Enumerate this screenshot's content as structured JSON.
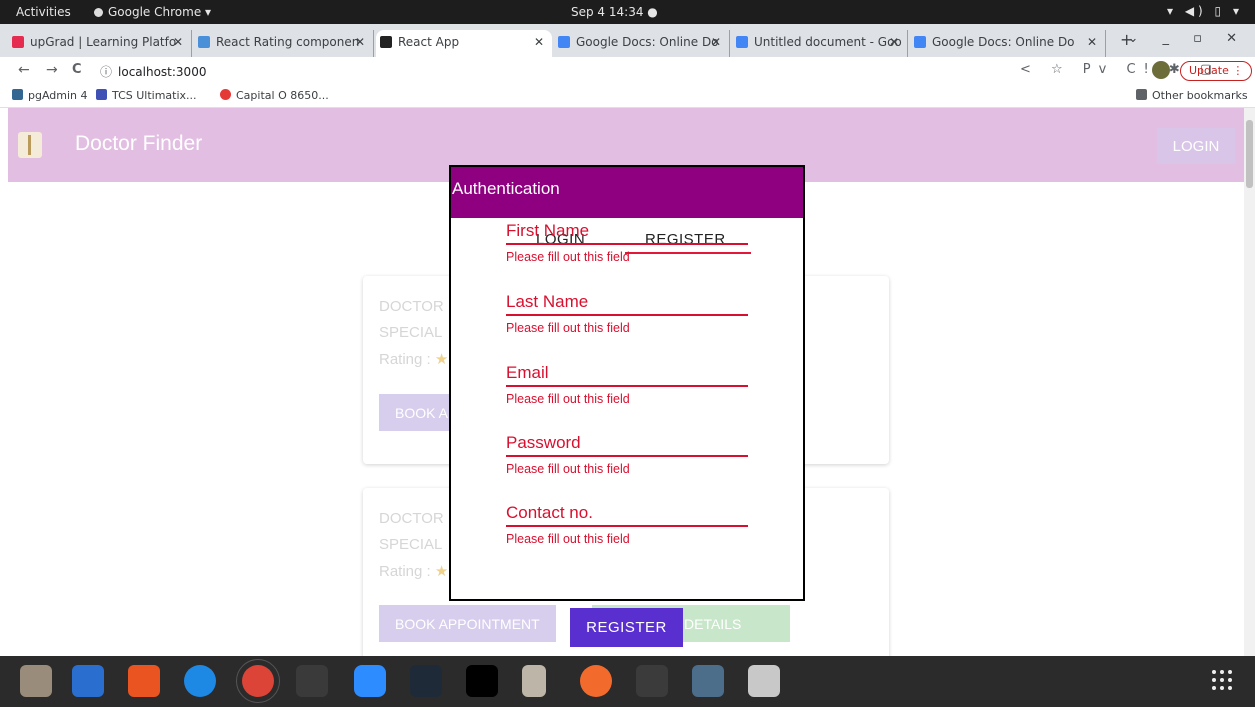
{
  "system": {
    "activities": "Activities",
    "app_name": "Google Chrome ▾",
    "clock": "Sep 4  14:34  ●",
    "tray": "▾ ◀) ▯ ▾"
  },
  "browser": {
    "tabs": [
      {
        "label": "upGrad | Learning Platfo",
        "favicon_color": "#e52b50"
      },
      {
        "label": "React Rating componen",
        "favicon_color": "#4a90d9"
      },
      {
        "label": "React App",
        "favicon_color": "#222222"
      },
      {
        "label": "Google Docs: Online Do",
        "favicon_color": "#4285f4"
      },
      {
        "label": "Untitled document - Goo",
        "favicon_color": "#4285f4"
      },
      {
        "label": "Google Docs: Online Do",
        "favicon_color": "#4285f4"
      }
    ],
    "new_tab": "+",
    "window_controls": "⌄ _ ▫ ✕",
    "nav": {
      "back": "←",
      "forward": "→",
      "reload": "C"
    },
    "url": "localhost:3000",
    "nav_icons": "< ☆ Pv C! ✱ ▢",
    "update_label": "Update ⋮",
    "bookmarks": [
      {
        "label": "pgAdmin 4",
        "color": "#336791"
      },
      {
        "label": "TCS Ultimatix...",
        "color": "#3f51b5"
      },
      {
        "label": "Capital O 8650...",
        "color": "#e53935"
      }
    ],
    "other_bookmarks": "Other bookmarks"
  },
  "page": {
    "brand": "Doctor Finder",
    "login_button": "LOGIN",
    "cards": [
      {
        "line1": "DOCTOR",
        "line2": "SPECIAL",
        "rating_label": "Rating :",
        "book_label": "BOOK A"
      },
      {
        "line1": "DOCTOR",
        "line2": "SPECIAL",
        "rating_label": "Rating :",
        "book_label": "BOOK APPOINTMENT",
        "details_label": "DETAILS"
      }
    ],
    "star": "★"
  },
  "modal": {
    "title": "Authentication",
    "tabs": {
      "login": "LOGIN",
      "register": "REGISTER"
    },
    "fields": [
      {
        "label": "First Name",
        "error": "Please fill out this field"
      },
      {
        "label": "Last Name",
        "error": "Please fill out this field"
      },
      {
        "label": "Email",
        "error": "Please fill out this field"
      },
      {
        "label": "Password",
        "error": "Please fill out this field"
      },
      {
        "label": "Contact no.",
        "error": "Please fill out this field"
      }
    ],
    "register_button": "REGISTER"
  },
  "colors": {
    "appbar": "#e1bee2",
    "modal_header": "#8e0080",
    "error": "#d8102f",
    "register_button": "#5a2fcf"
  },
  "dock": [
    "files-icon",
    "writer-icon",
    "software-icon",
    "help-icon",
    "chrome-icon",
    "sublime-icon",
    "zoom-icon",
    "vscode-icon",
    "intellij-icon",
    "archive-icon",
    "postman-icon",
    "terminal-icon",
    "mysql-workbench-icon",
    "screenshot-icon"
  ]
}
